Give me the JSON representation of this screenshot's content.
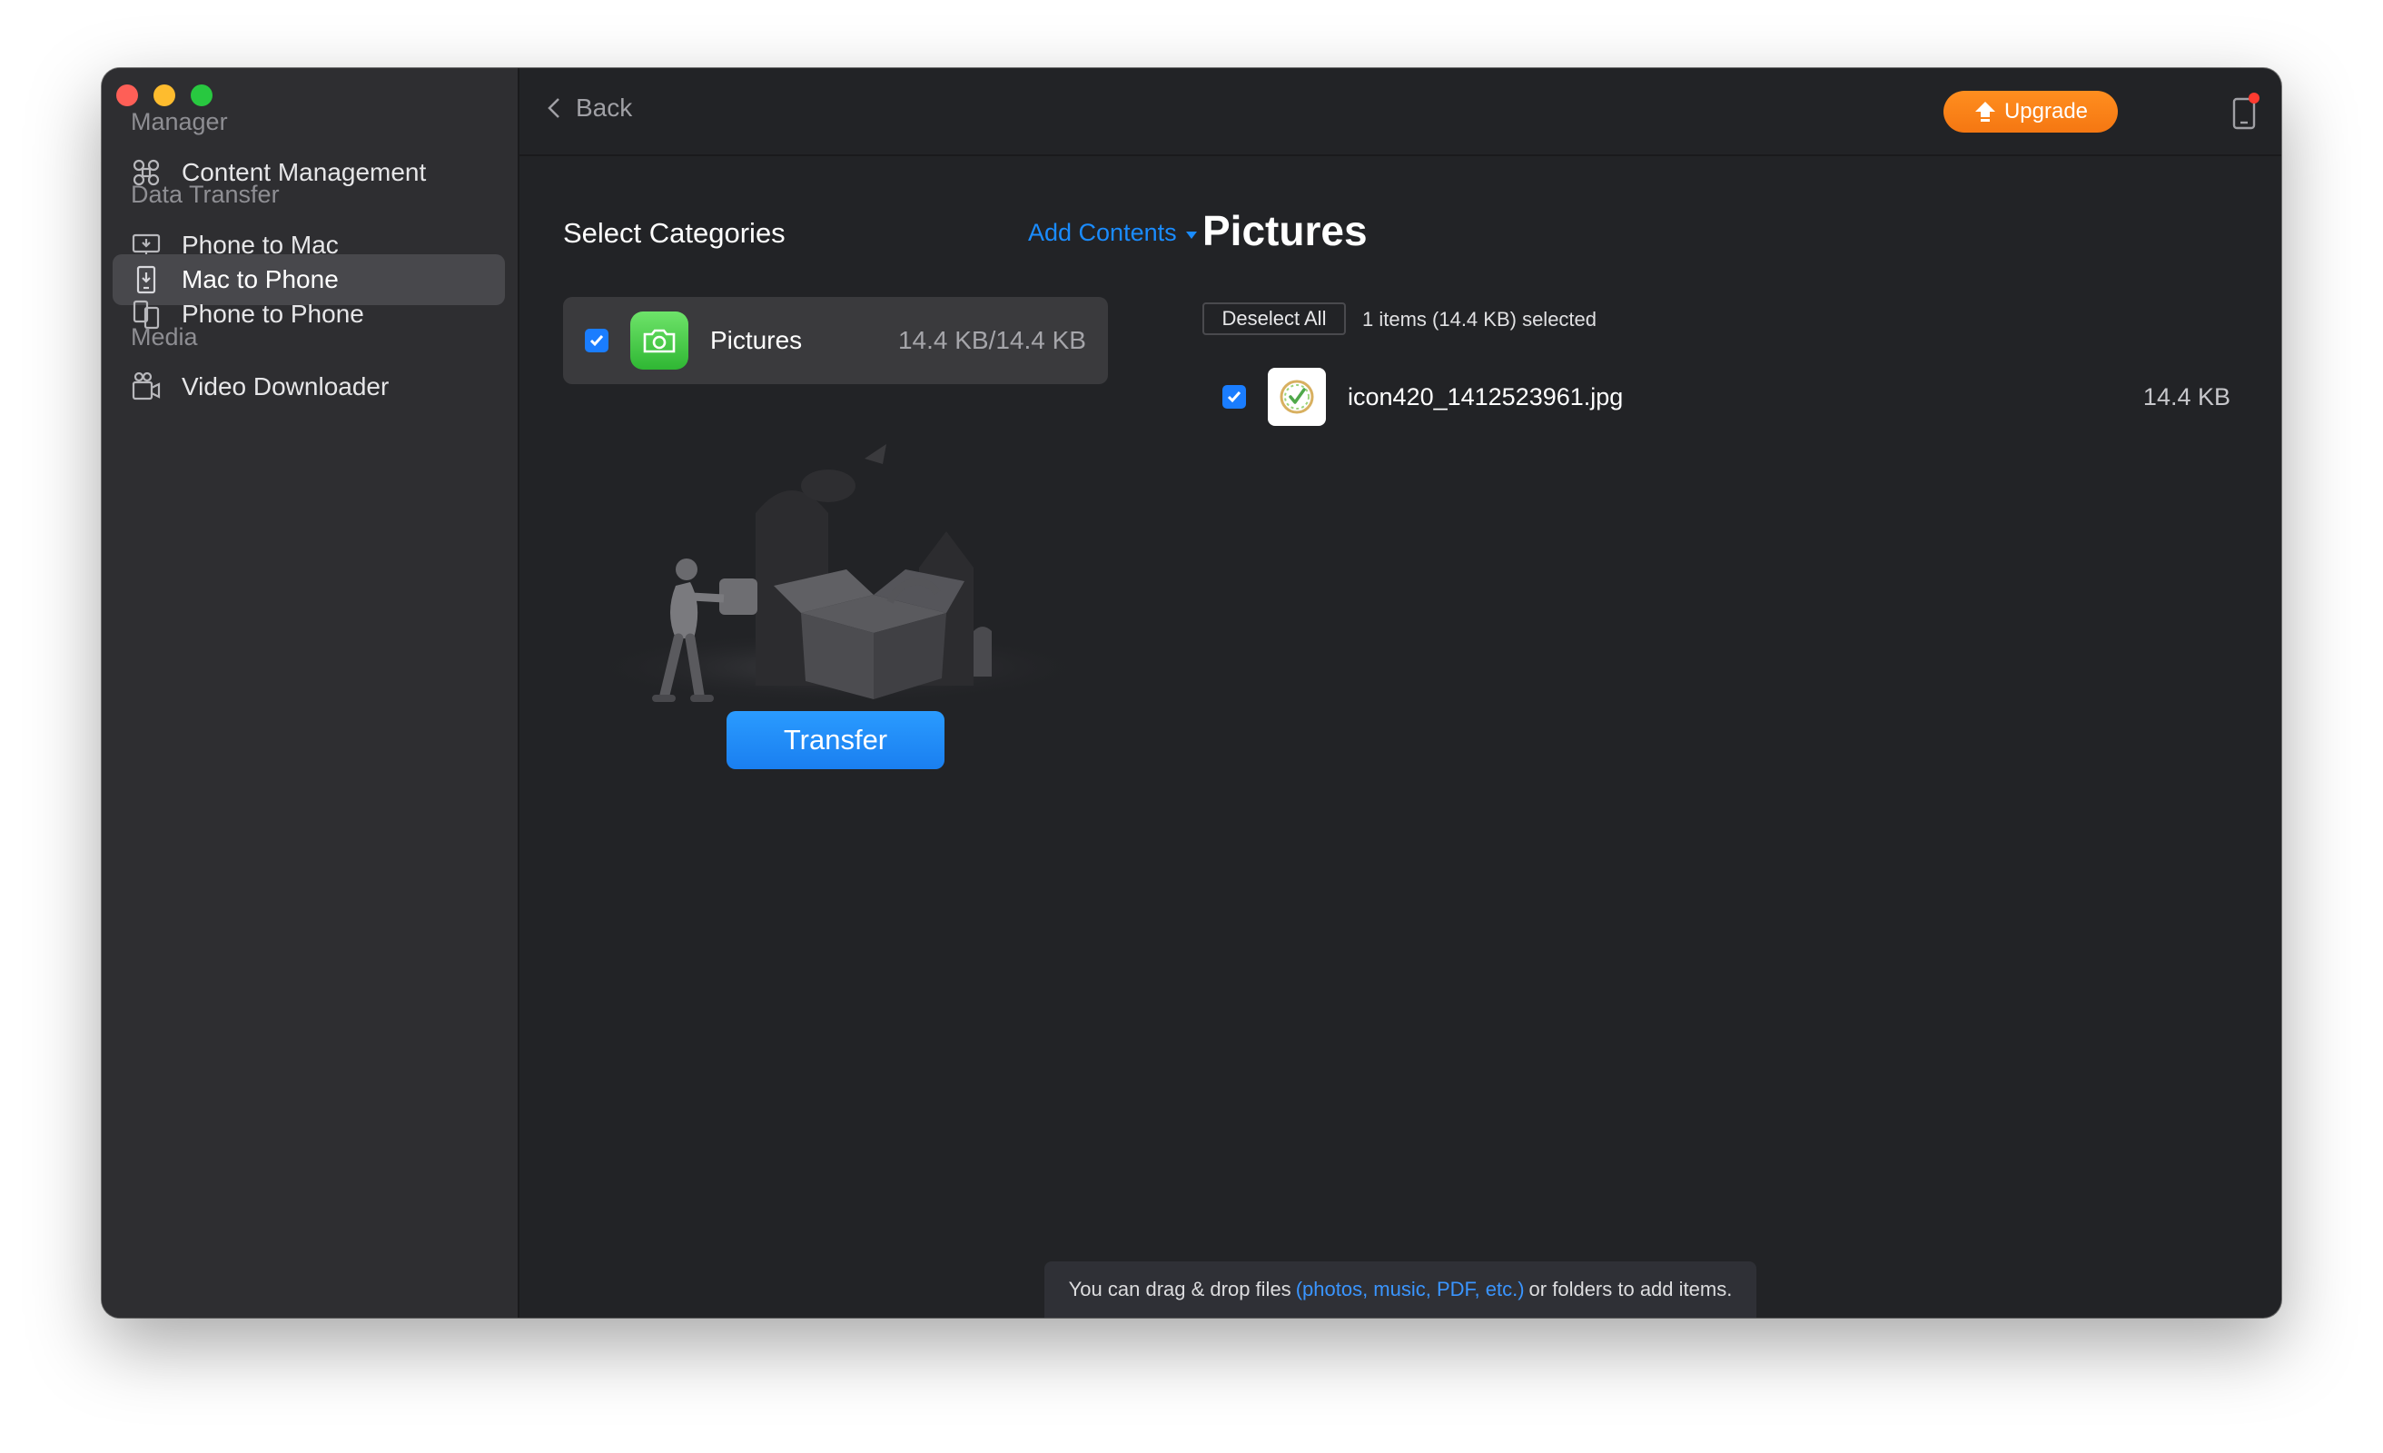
{
  "sidebar": {
    "sections": [
      {
        "label": "Manager",
        "items": [
          {
            "label": "Content Management",
            "icon": "cmd-icon"
          }
        ]
      },
      {
        "label": "Data Transfer",
        "items": [
          {
            "label": "Phone to Mac",
            "icon": "phone-to-mac-icon"
          },
          {
            "label": "Mac to Phone",
            "icon": "mac-to-phone-icon",
            "active": true
          },
          {
            "label": "Phone to Phone",
            "icon": "phone-to-phone-icon"
          }
        ]
      },
      {
        "label": "Media",
        "items": [
          {
            "label": "Video Downloader",
            "icon": "video-download-icon"
          }
        ]
      }
    ]
  },
  "topbar": {
    "back_label": "Back",
    "upgrade_label": "Upgrade",
    "upgrade_color": "#f57712",
    "device_icon": "device-icon",
    "notification_badge_color": "#ff3b30",
    "shop_icon": "tshirt-icon"
  },
  "categories": {
    "title": "Select Categories",
    "add_contents_label": "Add Contents",
    "items": [
      {
        "name": "Pictures",
        "size": "14.4 KB/14.4 KB",
        "checked": true,
        "icon": "camera-icon"
      }
    ],
    "transfer_label": "Transfer"
  },
  "detail": {
    "title": "Pictures",
    "deselect_label": "Deselect All",
    "selection_summary": "1 items (14.4 KB) selected",
    "files": [
      {
        "name": "icon420_1412523961.jpg",
        "size": "14.4 KB",
        "checked": true
      }
    ]
  },
  "hint": {
    "prefix": "You can drag & drop files",
    "link": "(photos, music, PDF, etc.)",
    "suffix": "or folders to add items."
  },
  "colors": {
    "accent": "#1a7dff",
    "background": "#222326",
    "sidebar": "#2e2e31"
  }
}
